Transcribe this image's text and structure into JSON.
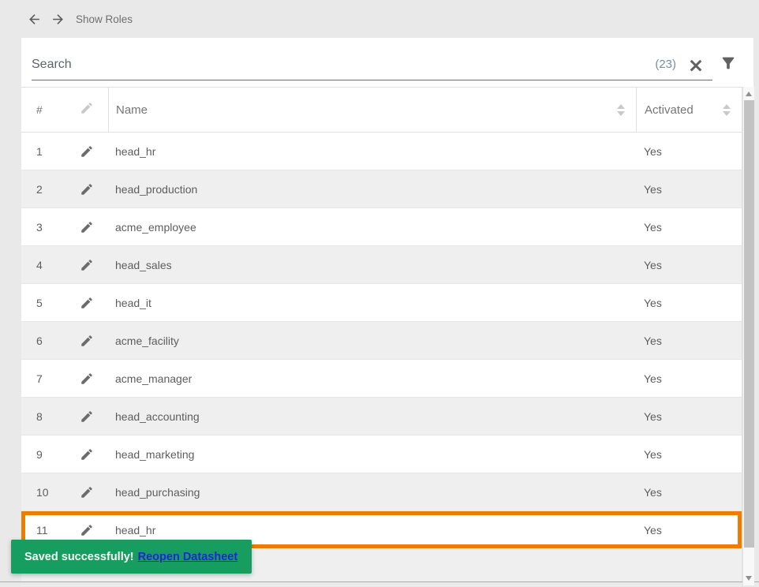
{
  "topbar": {
    "title": "Show Roles"
  },
  "search": {
    "placeholder": "Search",
    "value": "",
    "count": "(23)"
  },
  "icons": {
    "back": "arrow-left",
    "forward": "arrow-right",
    "clear": "x-cross",
    "filter": "funnel",
    "edit": "pencil",
    "sort": "up-down-triangles"
  },
  "table": {
    "headers": {
      "index": "#",
      "name": "Name",
      "activated": "Activated"
    },
    "rows": [
      {
        "index": "1",
        "name": "head_hr",
        "activated": "Yes"
      },
      {
        "index": "2",
        "name": "head_production",
        "activated": "Yes"
      },
      {
        "index": "3",
        "name": "acme_employee",
        "activated": "Yes"
      },
      {
        "index": "4",
        "name": "head_sales",
        "activated": "Yes"
      },
      {
        "index": "5",
        "name": "head_it",
        "activated": "Yes"
      },
      {
        "index": "6",
        "name": "acme_facility",
        "activated": "Yes"
      },
      {
        "index": "7",
        "name": "acme_manager",
        "activated": "Yes"
      },
      {
        "index": "8",
        "name": "head_accounting",
        "activated": "Yes"
      },
      {
        "index": "9",
        "name": "head_marketing",
        "activated": "Yes"
      },
      {
        "index": "10",
        "name": "head_purchasing",
        "activated": "Yes"
      },
      {
        "index": "11",
        "name": "head_hr",
        "activated": "Yes",
        "highlighted": true
      },
      {
        "index": "",
        "name": "",
        "activated": ""
      }
    ]
  },
  "toast": {
    "message": "Saved successfully!",
    "link": "Reopen Datasheet"
  },
  "colors": {
    "highlight": "#ed7d00",
    "toast": "#189d60",
    "link": "#2424d6",
    "count": "#78909c"
  }
}
